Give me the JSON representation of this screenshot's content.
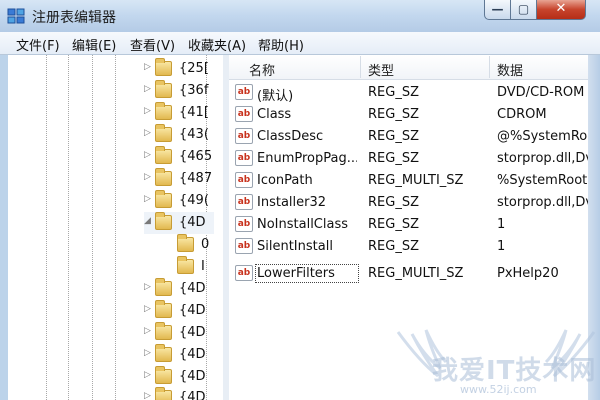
{
  "window": {
    "title": "注册表编辑器",
    "buttons": {
      "minimize": "—",
      "maximize": "▢",
      "close": "✕"
    }
  },
  "menu": [
    "文件(F)",
    "编辑(E)",
    "查看(V)",
    "收藏夹(A)",
    "帮助(H)"
  ],
  "tree": {
    "items": [
      {
        "label": "{25[",
        "expander": "▷"
      },
      {
        "label": "{36f",
        "expander": "▷"
      },
      {
        "label": "{41[",
        "expander": "▷"
      },
      {
        "label": "{43(",
        "expander": "▷"
      },
      {
        "label": "{465",
        "expander": "▷"
      },
      {
        "label": "{487",
        "expander": "▷"
      },
      {
        "label": "{49(",
        "expander": "▷"
      },
      {
        "label": "{4D",
        "expander": "◢"
      },
      {
        "label": "0",
        "expander": ""
      },
      {
        "label": "I",
        "expander": ""
      },
      {
        "label": "{4D",
        "expander": "▷"
      },
      {
        "label": "{4D",
        "expander": "▷"
      },
      {
        "label": "{4D",
        "expander": "▷"
      },
      {
        "label": "{4D",
        "expander": "▷"
      },
      {
        "label": "{4D",
        "expander": "▷"
      },
      {
        "label": "{4D",
        "expander": "▷"
      }
    ]
  },
  "list": {
    "columns": [
      "名称",
      "类型",
      "数据"
    ],
    "icon_text": "ab",
    "rows": [
      {
        "name": "(默认)",
        "type": "REG_SZ",
        "data": "DVD/CD-ROM"
      },
      {
        "name": "Class",
        "type": "REG_SZ",
        "data": "CDROM"
      },
      {
        "name": "ClassDesc",
        "type": "REG_SZ",
        "data": "@%SystemRoo"
      },
      {
        "name": "EnumPropPag...",
        "type": "REG_SZ",
        "data": "storprop.dll,Dv"
      },
      {
        "name": "IconPath",
        "type": "REG_MULTI_SZ",
        "data": "%SystemRoot%"
      },
      {
        "name": "Installer32",
        "type": "REG_SZ",
        "data": "storprop.dll,Dv"
      },
      {
        "name": "NoInstallClass",
        "type": "REG_SZ",
        "data": "1"
      },
      {
        "name": "SilentInstall",
        "type": "REG_SZ",
        "data": "1"
      },
      {
        "name": "LowerFilters",
        "type": "REG_MULTI_SZ",
        "data": "PxHelp20",
        "selected": true
      }
    ]
  },
  "watermark": {
    "text": "我爱IT技术网",
    "url": "www.52ij.com"
  },
  "colors": {
    "titlebar": "#c2d7ee",
    "close_button": "#c7442c",
    "folder": "#e2b84f",
    "value_icon": "#c8321d"
  }
}
